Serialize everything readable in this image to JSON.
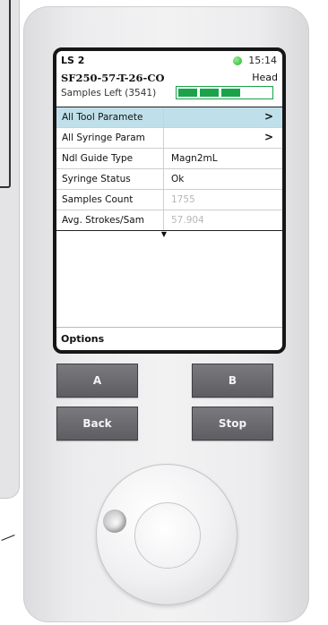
{
  "screen": {
    "title": "LS 2",
    "time": "15:14",
    "sample_id": "SF250-57-T-26-CO",
    "mode": "Head",
    "samples_left": "Samples Left (3541)",
    "progress_segments": 3,
    "rows": [
      {
        "label": "All Tool Paramete",
        "value": "",
        "arrow": ">",
        "selected": true
      },
      {
        "label": "All Syringe Param",
        "value": "",
        "arrow": ">",
        "selected": false
      },
      {
        "label": "Ndl Guide Type",
        "value": "Magn2mL",
        "arrow": "",
        "selected": false
      },
      {
        "label": "Syringe Status",
        "value": "Ok",
        "arrow": "",
        "selected": false
      },
      {
        "label": "Samples Count",
        "value": "1755",
        "arrow": "",
        "selected": false
      },
      {
        "label": "Avg. Strokes/Sam",
        "value": "57.904",
        "arrow": "",
        "selected": false
      }
    ],
    "scroll_down_glyph": "▼",
    "options_label": "Options"
  },
  "buttons": {
    "a": "A",
    "b": "B",
    "back": "Back",
    "stop": "Stop"
  },
  "colors": {
    "status_dot": "#2bb02b",
    "progress": "#1aa34a",
    "selected_row": "#bfe0ea",
    "button": "#6a6a6e"
  },
  "icons": {
    "status": "green-status-dot",
    "row_arrow": "chevron-right",
    "scroll": "triangle-down"
  }
}
